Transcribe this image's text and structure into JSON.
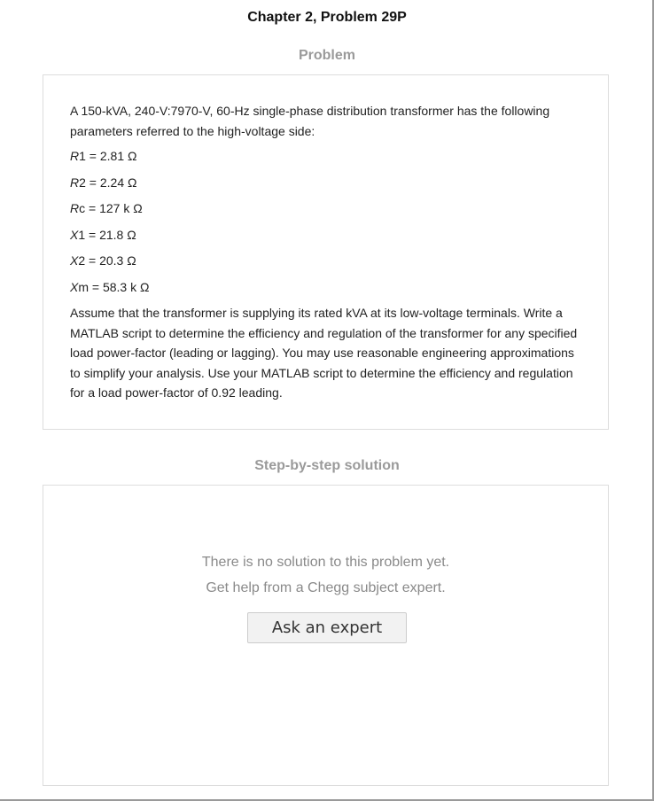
{
  "header": {
    "title": "Chapter 2, Problem 29P"
  },
  "problem": {
    "heading": "Problem",
    "intro": "A 150-kVA, 240-V:7970-V, 60-Hz single-phase distribution transformer has the following parameters referred to the high-voltage side:",
    "parameters": [
      {
        "sym": "R",
        "sub": "1",
        "rest": " = 2.81 Ω"
      },
      {
        "sym": "R",
        "sub": "2",
        "rest": " = 2.24 Ω"
      },
      {
        "sym": "R",
        "sub": "c",
        "rest": " = 127 k Ω"
      },
      {
        "sym": "X",
        "sub": "1",
        "rest": " = 21.8 Ω"
      },
      {
        "sym": "X",
        "sub": "2",
        "rest": " = 20.3 Ω"
      },
      {
        "sym": "X",
        "sub": "m",
        "rest": " = 58.3 k Ω"
      }
    ],
    "body": "Assume that the transformer is supplying its rated kVA at its low-voltage terminals. Write a MATLAB script to determine the efficiency and regulation of the transformer for any specified load power-factor (leading or lagging). You may use reasonable engineering approximations to simplify your analysis. Use your MATLAB script to determine the efficiency and regulation for a load power-factor of 0.92 leading."
  },
  "solution": {
    "heading": "Step-by-step solution",
    "empty_line1": "There is no solution to this problem yet.",
    "empty_line2": "Get help from a Chegg subject expert.",
    "ask_button_label": "Ask an expert"
  }
}
